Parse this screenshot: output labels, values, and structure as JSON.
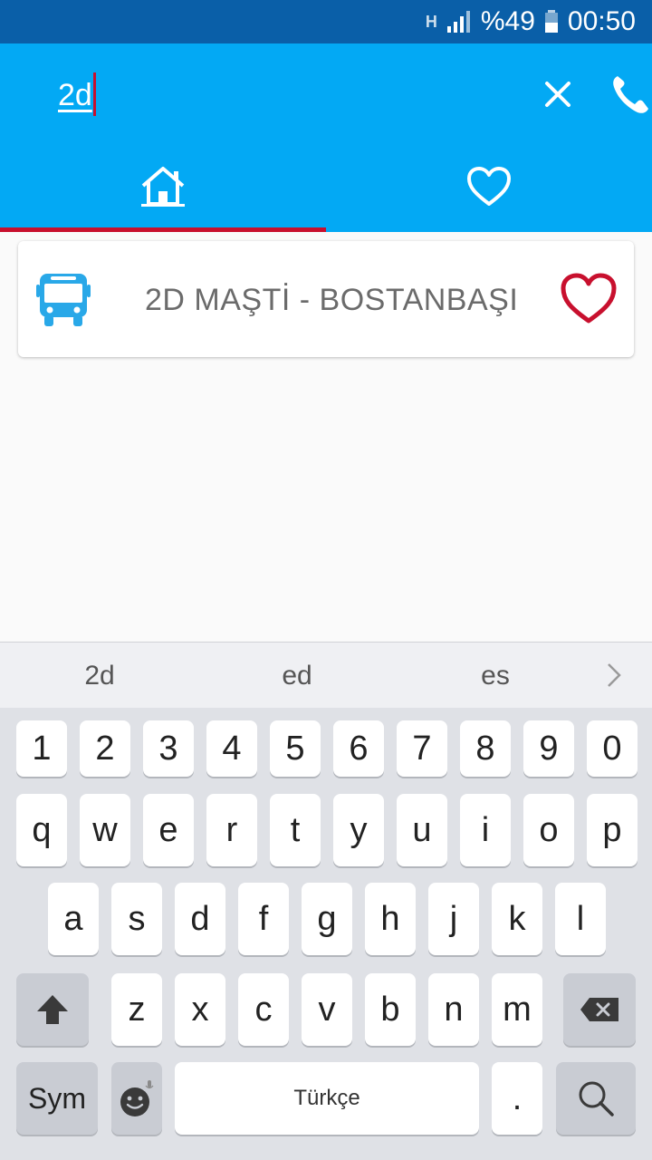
{
  "status_bar": {
    "network": "H",
    "battery": "%49",
    "time": "00:50"
  },
  "search": {
    "value": "2d"
  },
  "tabs": [
    {
      "name": "home",
      "icon": "home-icon"
    },
    {
      "name": "favorites",
      "icon": "heart-outline-icon"
    }
  ],
  "results": [
    {
      "icon": "bus-icon",
      "label": "2D MAŞTİ - BOSTANBAŞI",
      "favorite_icon": "heart-outline-icon"
    }
  ],
  "keyboard": {
    "suggestions": [
      "2d",
      "ed",
      "es"
    ],
    "row_numbers": [
      "1",
      "2",
      "3",
      "4",
      "5",
      "6",
      "7",
      "8",
      "9",
      "0"
    ],
    "row1": [
      "q",
      "w",
      "e",
      "r",
      "t",
      "y",
      "u",
      "i",
      "o",
      "p"
    ],
    "row2": [
      "a",
      "s",
      "d",
      "f",
      "g",
      "h",
      "j",
      "k",
      "l"
    ],
    "row3": [
      "z",
      "x",
      "c",
      "v",
      "b",
      "n",
      "m"
    ],
    "sym_label": "Sym",
    "space_label": "Türkçe",
    "period_label": "."
  },
  "colors": {
    "status_bar": "#0a5fa8",
    "app_bar": "#03a9f4",
    "accent": "#c8102e",
    "bus_icon": "#29a8e8"
  }
}
